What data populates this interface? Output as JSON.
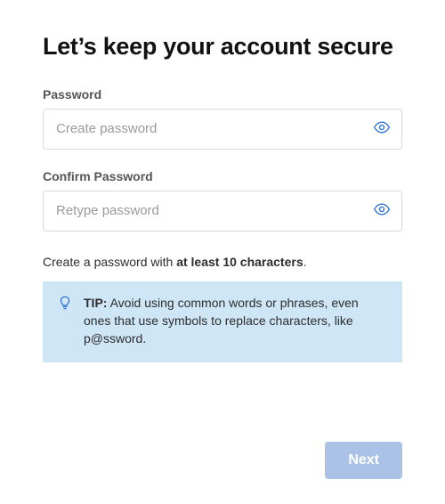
{
  "heading": "Let’s keep your account secure",
  "password": {
    "label": "Password",
    "placeholder": "Create password"
  },
  "confirm": {
    "label": "Confirm Password",
    "placeholder": "Retype password"
  },
  "rule": {
    "prefix": "Create a password with ",
    "bold": "at least 10 characters",
    "suffix": "."
  },
  "tip": {
    "label": "TIP:",
    "body": " Avoid using common words or phrases, even ones that use symbols to replace characters, like p@ssword."
  },
  "next_label": "Next"
}
